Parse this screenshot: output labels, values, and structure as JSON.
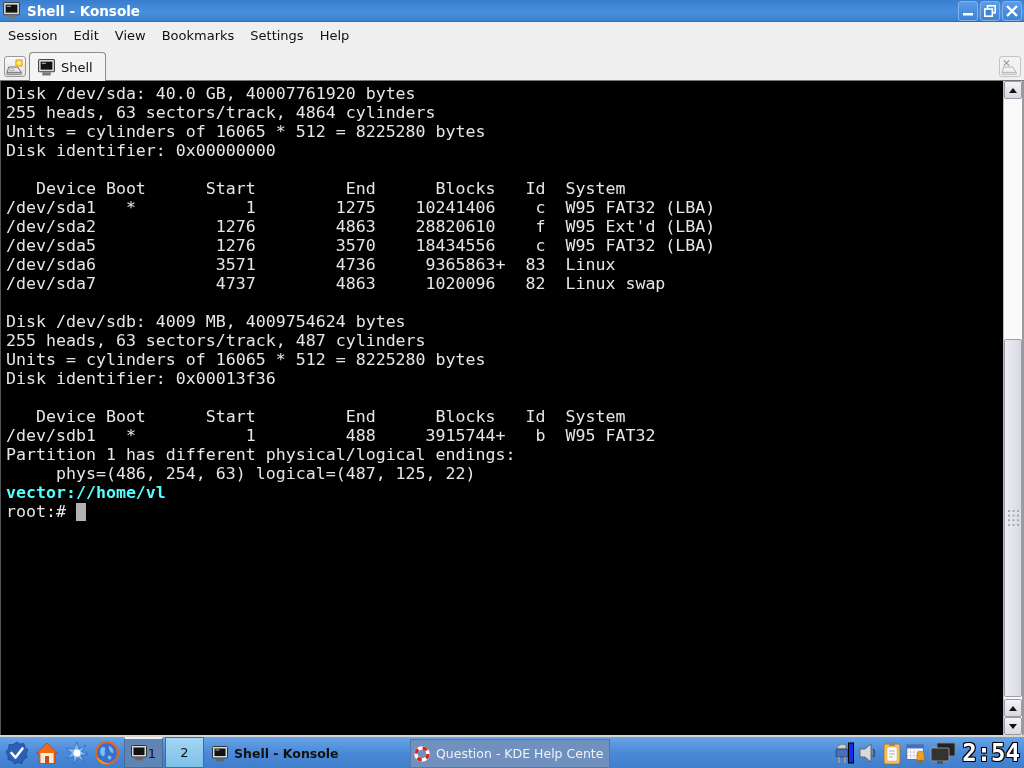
{
  "window": {
    "title": "Shell - Konsole"
  },
  "menu": [
    "Session",
    "Edit",
    "View",
    "Bookmarks",
    "Settings",
    "Help"
  ],
  "tabs": [
    {
      "label": "Shell",
      "selected": true
    }
  ],
  "terminal": {
    "blocks": [
      {
        "lines": [
          {
            "kind": "output",
            "text": "Disk /dev/sda: 40.0 GB, 40007761920 bytes"
          },
          {
            "kind": "output",
            "text": "255 heads, 63 sectors/track, 4864 cylinders"
          },
          {
            "kind": "output",
            "text": "Units = cylinders of 16065 * 512 = 8225280 bytes"
          },
          {
            "kind": "output",
            "text": "Disk identifier: 0x00000000"
          }
        ]
      },
      {
        "lines": [
          {
            "kind": "output",
            "text": "   Device Boot      Start         End      Blocks   Id  System"
          },
          {
            "kind": "output",
            "text": "/dev/sda1   *           1        1275    10241406    c  W95 FAT32 (LBA)"
          },
          {
            "kind": "output",
            "text": "/dev/sda2            1276        4863    28820610    f  W95 Ext'd (LBA)"
          },
          {
            "kind": "output",
            "text": "/dev/sda5            1276        3570    18434556    c  W95 FAT32 (LBA)"
          },
          {
            "kind": "output",
            "text": "/dev/sda6            3571        4736     9365863+  83  Linux"
          },
          {
            "kind": "output",
            "text": "/dev/sda7            4737        4863     1020096   82  Linux swap"
          }
        ]
      },
      {
        "lines": [
          {
            "kind": "output",
            "text": "Disk /dev/sdb: 4009 MB, 4009754624 bytes"
          },
          {
            "kind": "output",
            "text": "255 heads, 63 sectors/track, 487 cylinders"
          },
          {
            "kind": "output",
            "text": "Units = cylinders of 16065 * 512 = 8225280 bytes"
          },
          {
            "kind": "output",
            "text": "Disk identifier: 0x00013f36"
          }
        ]
      },
      {
        "lines": [
          {
            "kind": "output",
            "text": "   Device Boot      Start         End      Blocks   Id  System"
          },
          {
            "kind": "output",
            "text": "/dev/sdb1   *           1         488     3915744+   b  W95 FAT32"
          },
          {
            "kind": "output",
            "text": "Partition 1 has different physical/logical endings:"
          },
          {
            "kind": "output",
            "text": "     phys=(486, 254, 63) logical=(487, 125, 22)"
          },
          {
            "kind": "path",
            "text": "vector://home/vl"
          },
          {
            "kind": "prompt",
            "text": "root:#"
          }
        ]
      }
    ]
  },
  "taskbar": {
    "pager": [
      {
        "label": "1",
        "selected": false,
        "occupied": true
      },
      {
        "label": "2",
        "selected": true,
        "occupied": false
      }
    ],
    "tasks": [
      {
        "kind": "terminal",
        "label": "Shell - Konsole",
        "selected": true
      },
      {
        "kind": "help",
        "label": "Question - KDE Help Cente",
        "selected": false
      }
    ],
    "clock": "2:54"
  }
}
